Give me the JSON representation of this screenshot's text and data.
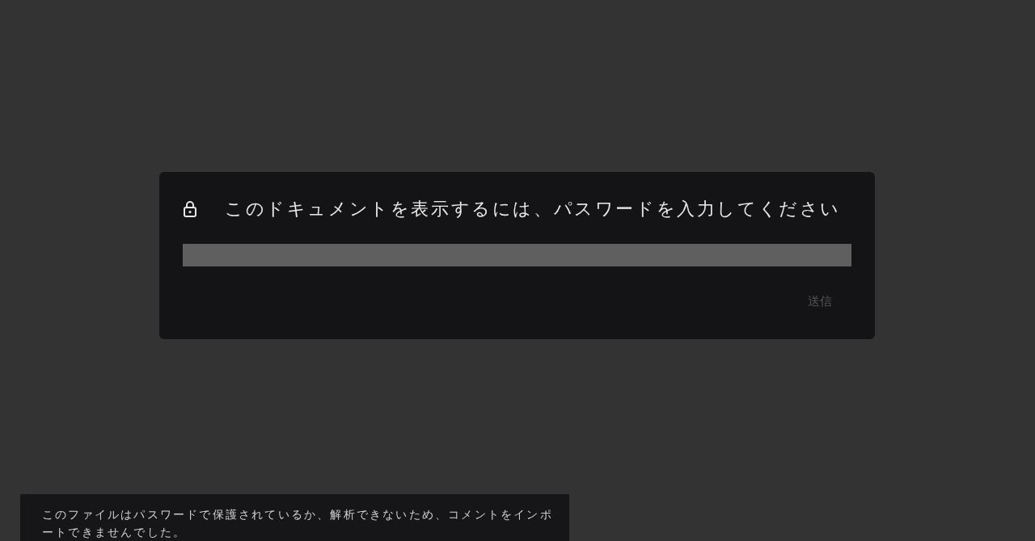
{
  "dialog": {
    "title": "このドキュメントを表示するには、パスワードを入力してください",
    "submit_button": {
      "label": "送信",
      "disabled": true
    }
  },
  "toast": {
    "message": "このファイルはパスワードで保護されているか、解析できないため、コメントをインポートできませんでした。"
  }
}
